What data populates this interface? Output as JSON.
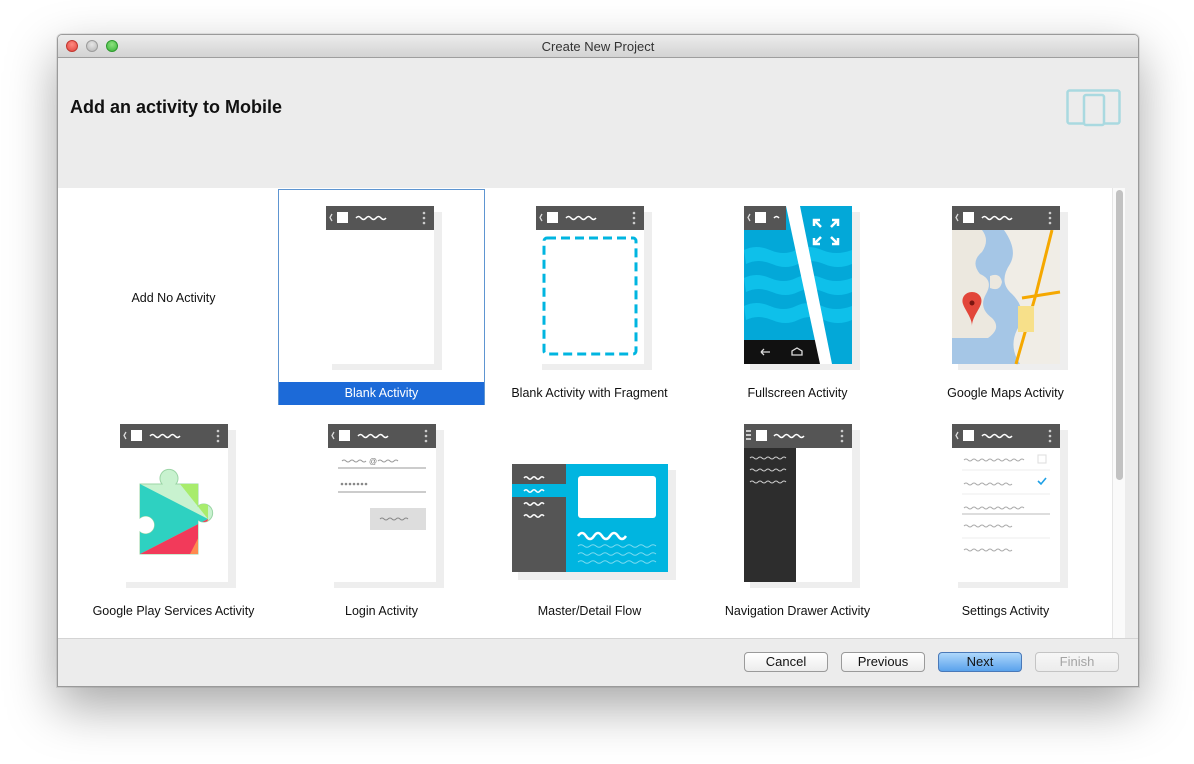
{
  "window": {
    "title": "Create New Project"
  },
  "header": {
    "title": "Add an activity to Mobile",
    "icon": "devices-icon"
  },
  "activities": [
    {
      "label": "Add No Activity",
      "selected": false
    },
    {
      "label": "Blank Activity",
      "selected": true
    },
    {
      "label": "Blank Activity with Fragment",
      "selected": false
    },
    {
      "label": "Fullscreen Activity",
      "selected": false
    },
    {
      "label": "Google Maps Activity",
      "selected": false
    },
    {
      "label": "Google Play Services Activity",
      "selected": false
    },
    {
      "label": "Login Activity",
      "selected": false
    },
    {
      "label": "Master/Detail Flow",
      "selected": false
    },
    {
      "label": "Navigation Drawer Activity",
      "selected": false
    },
    {
      "label": "Settings Activity",
      "selected": false
    }
  ],
  "footer": {
    "cancel": "Cancel",
    "previous": "Previous",
    "next": "Next",
    "finish": "Finish",
    "finish_enabled": false
  },
  "colors": {
    "selection": "#1c6ad8",
    "accent": "#00b5e0",
    "phone_bar": "#555555"
  }
}
